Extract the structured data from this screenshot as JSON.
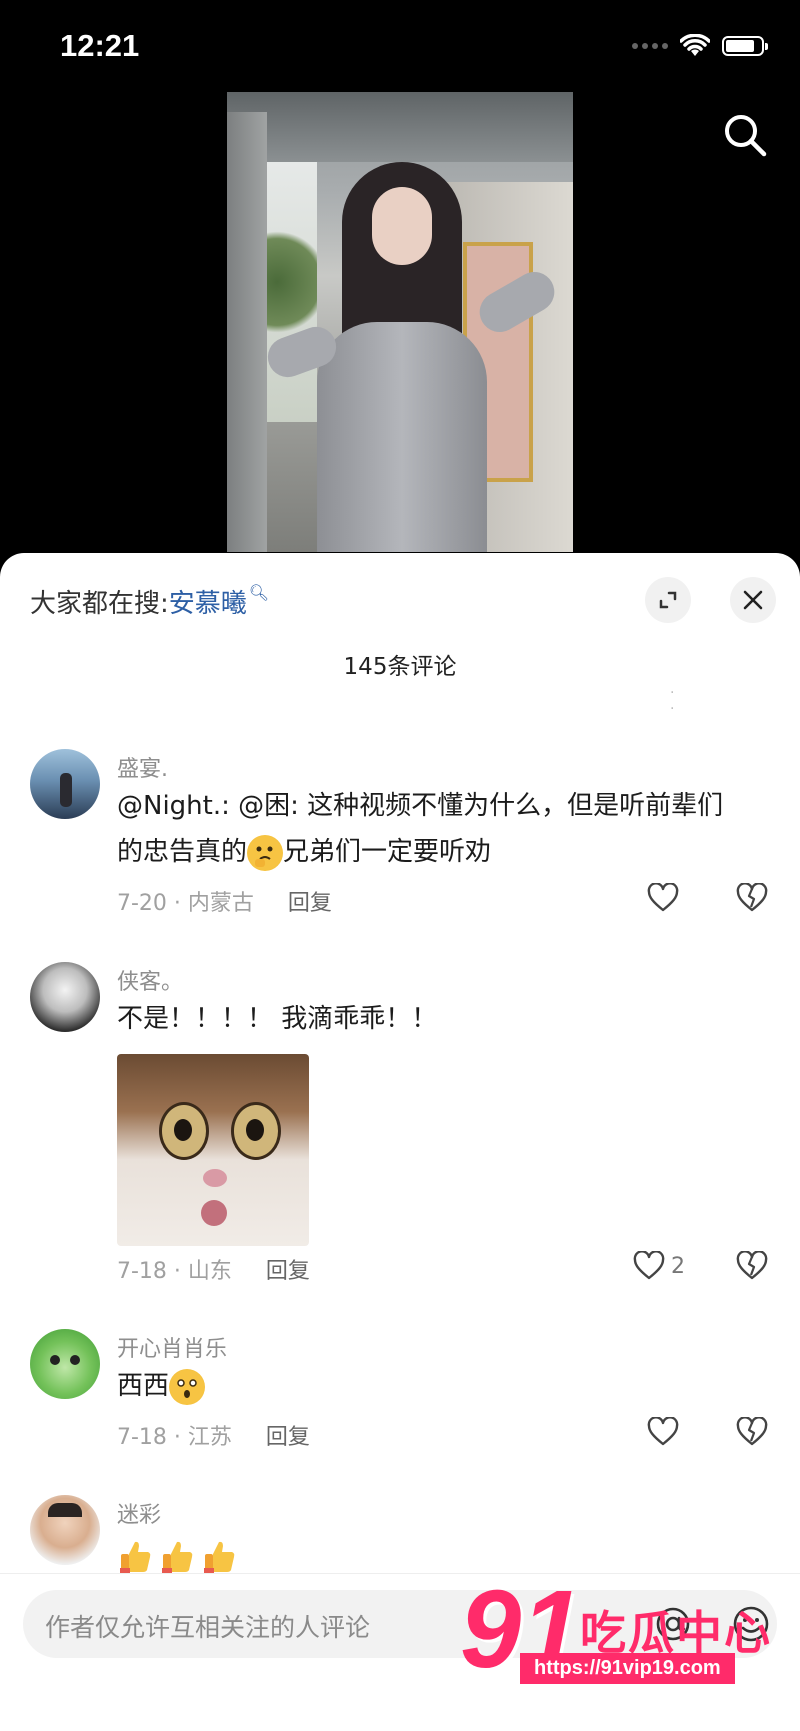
{
  "status_bar": {
    "time": "12:21"
  },
  "sheet": {
    "hot_search_prefix": "大家都在搜:",
    "hot_search_keyword": "安慕曦",
    "comment_count": "145条评论"
  },
  "comments": [
    {
      "username": "盛宴.",
      "text_line1": "@Night.: @困: 这种视频不懂为什么，但是听前辈们",
      "text_line2_a": "的忠告真的",
      "text_line2_b": "兄弟们一定要听劝",
      "date_location": "7-20 · 内蒙古",
      "reply": "回复",
      "likes": ""
    },
    {
      "username": "侠客。",
      "text": "不是！！！！ 我滴乖乖！！",
      "date_location": "7-18 · 山东",
      "reply": "回复",
      "likes": "2"
    },
    {
      "username": "开心肖肖乐",
      "text": "西西",
      "date_location": "7-18 · 江苏",
      "reply": "回复",
      "likes": ""
    },
    {
      "username": "迷彩",
      "text": ""
    }
  ],
  "input": {
    "placeholder": "作者仅允许互相关注的人评论"
  },
  "watermark": {
    "logo_digits": "91",
    "name": "吃瓜中心",
    "url": "https://91vip19.com"
  },
  "colors": {
    "accent_pink": "#ff2b6a",
    "link_blue": "#2d5fa5"
  }
}
